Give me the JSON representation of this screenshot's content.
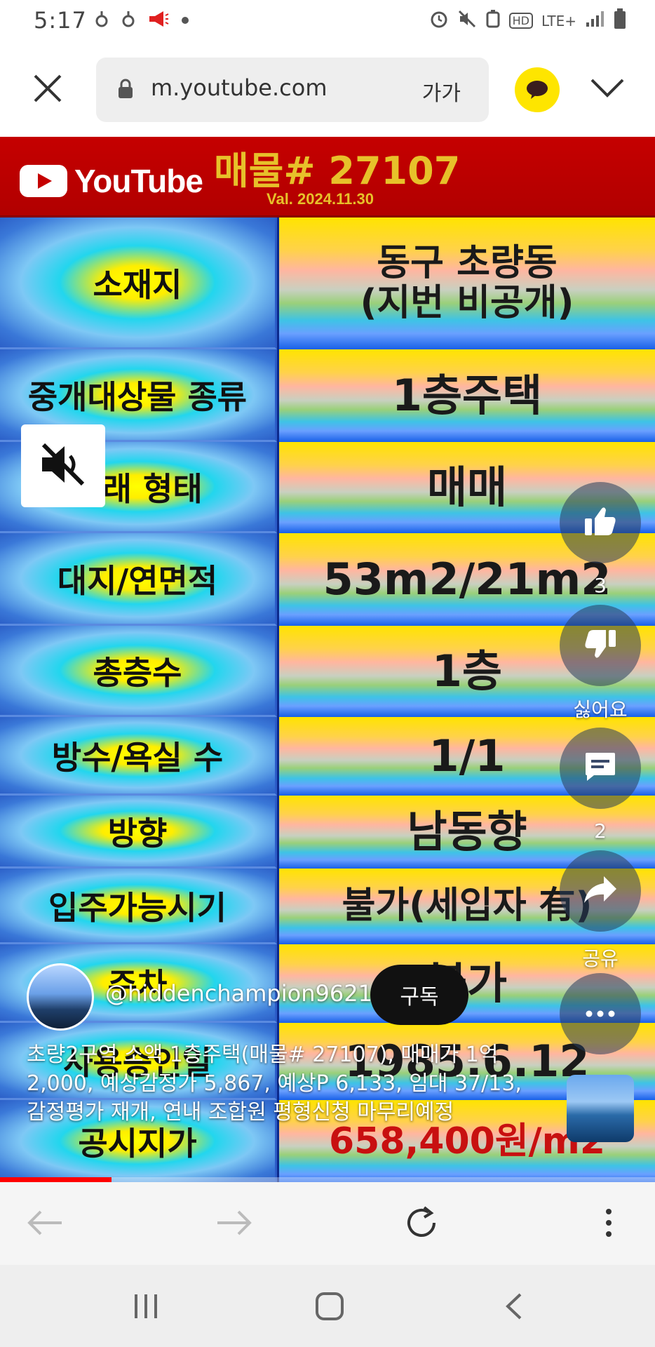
{
  "status_bar": {
    "time": "5:17",
    "network": "LTE+",
    "hd": "HD",
    "icons": [
      "notification-icon",
      "notification-icon",
      "megaphone-icon",
      "alarm-icon",
      "mute-icon",
      "battery-saver-icon",
      "signal-icon",
      "battery-icon"
    ]
  },
  "browser": {
    "url": "m.youtube.com",
    "text_size_label": "가가",
    "icons": [
      "close-icon",
      "lock-icon",
      "kakao-chat-icon",
      "chevron-down-icon"
    ]
  },
  "video": {
    "banner": {
      "brand": "YouTube",
      "title": "매물# 27107",
      "valuation": "Val. 2024.11.30"
    },
    "table": [
      {
        "label": "소재지",
        "value": "동구 초량동\n(지번 비공개)"
      },
      {
        "label": "중개대상물 종류",
        "value": "1층주택"
      },
      {
        "label": "거래 형태",
        "value": "매매"
      },
      {
        "label": "대지/연면적",
        "value": "53m2/21m2"
      },
      {
        "label": "총층수",
        "value": "1층"
      },
      {
        "label": "방수/욕실 수",
        "value": "1/1"
      },
      {
        "label": "방향",
        "value": "남동향"
      },
      {
        "label": "입주가능시기",
        "value": "불가(세입자 有)"
      },
      {
        "label": "주차",
        "value": "불가"
      },
      {
        "label": "사용승인일",
        "value": "1985.6.12"
      },
      {
        "label": "공시지가",
        "value": "658,400원/m2"
      }
    ],
    "actions": {
      "like_count": "3",
      "dislike_label": "싫어요",
      "comment_count": "2",
      "share_label": "공유"
    },
    "channel": {
      "handle": "@hiddenchampion9621",
      "subscribe_label": "구독"
    },
    "description": "초량2구역 소액 1층주택(매물# 27107), 매매가 1억 2,000, 예상감정가 5,867, 예상P 6,133, 임대 37/13, 감정평가 재개, 연내 조합원 평형신청 마무리예정",
    "progress": 0.17
  },
  "bottom_bar": {
    "icons": [
      "back-arrow-icon",
      "forward-arrow-icon",
      "reload-icon",
      "more-vert-icon"
    ]
  },
  "nav_bar": {
    "icons": [
      "recent-apps-icon",
      "home-icon",
      "back-icon"
    ]
  }
}
